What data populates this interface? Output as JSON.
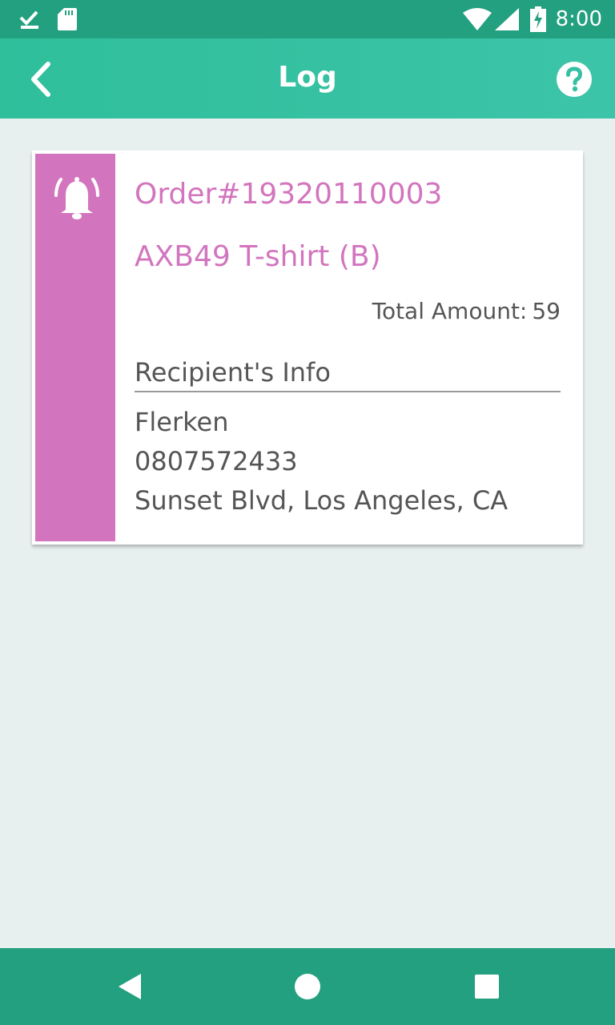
{
  "status_bar": {
    "time": "8:00",
    "icons": [
      "download-done-icon",
      "sd-card-icon",
      "wifi-icon",
      "signal-icon",
      "battery-charging-icon"
    ]
  },
  "app_bar": {
    "title": "Log",
    "back_icon": "chevron-left-icon",
    "help_icon": "help-circle-icon"
  },
  "log_card": {
    "accent_color": "#d275be",
    "icon": "bell-ringing-icon",
    "order_number": "Order#19320110003",
    "product": "AXB49 T-shirt (B)",
    "total_label": "Total Amount:",
    "total_value": "59",
    "recipient_title": "Recipient's Info",
    "recipient": {
      "name": "Flerken",
      "phone": "0807572433",
      "address": "Sunset Blvd, Los Angeles, CA"
    }
  },
  "nav_bar": {
    "icons": [
      "back-triangle-icon",
      "home-circle-icon",
      "recents-square-icon"
    ]
  },
  "colors": {
    "status_bar": "#23a07f",
    "app_bar": "#2fbf9b",
    "background": "#e8f0ef"
  }
}
